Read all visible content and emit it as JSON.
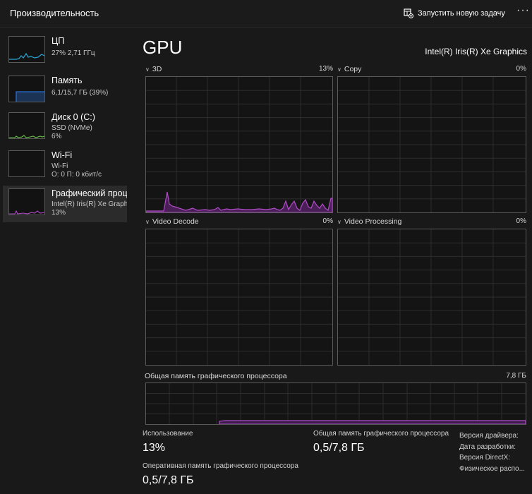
{
  "header": {
    "title": "Производительность",
    "run_task_label": "Запустить новую задачу",
    "more_label": "···"
  },
  "sidebar": {
    "items": [
      {
        "title": "ЦП",
        "sub1": "27% 2,71 ГГц",
        "sub2": ""
      },
      {
        "title": "Память",
        "sub1": "6,1/15,7 ГБ (39%)",
        "sub2": ""
      },
      {
        "title": "Диск 0 (C:)",
        "sub1": "SSD (NVMe)",
        "sub2": "6%"
      },
      {
        "title": "Wi-Fi",
        "sub1": "Wi-Fi",
        "sub2": "О: 0 П: 0 кбит/с"
      },
      {
        "title": "Графический процессор",
        "sub1": "Intel(R) Iris(R) Xe Graphics",
        "sub2": "13%"
      }
    ],
    "colors": {
      "cpu": "#2ba5d6",
      "memory": "#2b6fd6",
      "disk": "#6cc24a",
      "gpu": "#b04cc8"
    }
  },
  "main": {
    "title": "GPU",
    "gpu_name": "Intel(R) Iris(R) Xe Graphics",
    "graphs": [
      {
        "label": "3D",
        "percent": "13%"
      },
      {
        "label": "Copy",
        "percent": "0%"
      },
      {
        "label": "Video Decode",
        "percent": "0%"
      },
      {
        "label": "Video Processing",
        "percent": "0%"
      }
    ],
    "memory_graph": {
      "label": "Общая память графического процессора",
      "max": "7,8 ГБ"
    },
    "stats": {
      "usage_label": "Использование",
      "usage_value": "13%",
      "shared_mem_label": "Общая память графического процессора",
      "shared_mem_value": "0,5/7,8 ГБ",
      "dedicated_mem_label": "Оперативная память графического процессора",
      "dedicated_mem_value": "0,5/7,8 ГБ"
    },
    "info_labels": [
      "Версия драйвера:",
      "Дата разработки:",
      "Версия DirectX:",
      "Физическое распо..."
    ]
  },
  "accent_color": "#b04cc8"
}
